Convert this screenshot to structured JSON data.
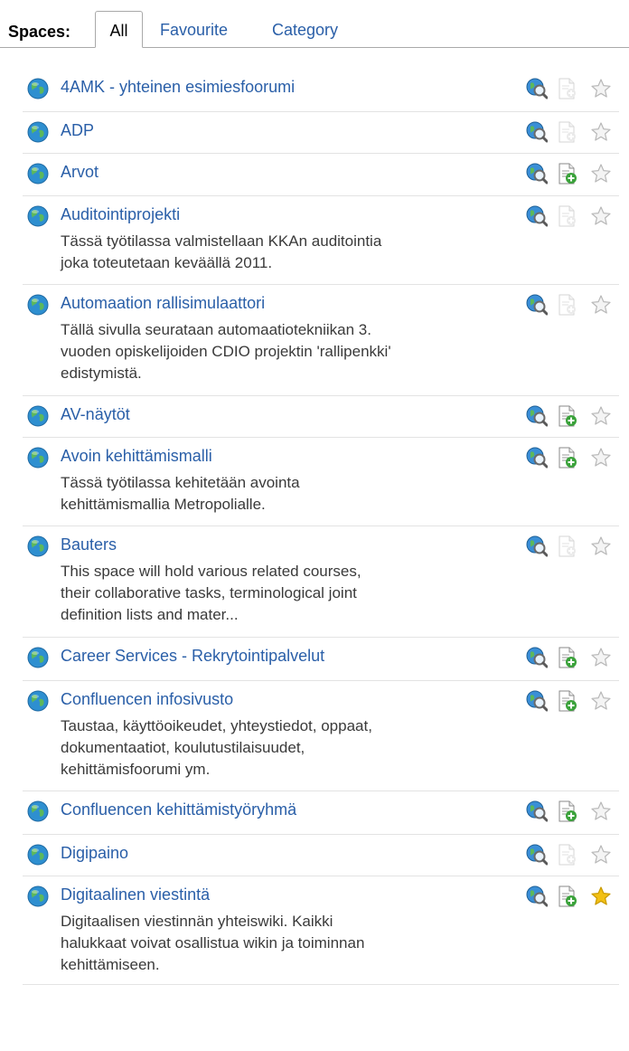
{
  "tabs": {
    "label": "Spaces:",
    "all": "All",
    "favourite": "Favourite",
    "category": "Category"
  },
  "colors": {
    "link": "#2a5fa8",
    "globe": "#2e8fd0",
    "add_enabled": "#3aa23a",
    "star_active": "#f2c014"
  },
  "spaces": [
    {
      "name": "4AMK - yhteinen esimiesfoorumi",
      "description": "",
      "add_page_enabled": false,
      "favourite": false
    },
    {
      "name": "ADP",
      "description": "",
      "add_page_enabled": false,
      "favourite": false
    },
    {
      "name": "Arvot",
      "description": "",
      "add_page_enabled": true,
      "favourite": false
    },
    {
      "name": "Auditointiprojekti",
      "description_lines": [
        "Tässä työtilassa valmistellaan KKAn auditointia",
        "joka toteutetaan keväällä 2011."
      ],
      "add_page_enabled": false,
      "favourite": false
    },
    {
      "name": "Automaation rallisimulaattori",
      "description_lines": [
        "Tällä sivulla seurataan automaatiotekniikan 3.",
        "vuoden opiskelijoiden CDIO projektin 'rallipenkki'",
        "edistymistä."
      ],
      "add_page_enabled": false,
      "favourite": false
    },
    {
      "name": "AV-näytöt",
      "description": "",
      "add_page_enabled": true,
      "favourite": false
    },
    {
      "name": "Avoin kehittämismalli",
      "description_lines": [
        "Tässä työtilassa kehitetään avointa",
        "kehittämismallia Metropolialle."
      ],
      "add_page_enabled": true,
      "favourite": false
    },
    {
      "name": "Bauters",
      "description_lines": [
        "This space will hold various related courses,",
        "their collaborative tasks, terminological joint",
        "definition lists and mater..."
      ],
      "add_page_enabled": false,
      "favourite": false
    },
    {
      "name": "Career Services - Rekrytointipalvelut",
      "description": "",
      "add_page_enabled": true,
      "favourite": false
    },
    {
      "name": "Confluencen infosivusto",
      "description_lines": [
        "Taustaa, käyttöoikeudet, yhteystiedot, oppaat,",
        "dokumentaatiot, koulutustilaisuudet,",
        "kehittämisfoorumi ym."
      ],
      "add_page_enabled": true,
      "favourite": false
    },
    {
      "name": "Confluencen kehittämistyöryhmä",
      "description": "",
      "add_page_enabled": true,
      "favourite": false
    },
    {
      "name": "Digipaino",
      "description": "",
      "add_page_enabled": false,
      "favourite": false
    },
    {
      "name": "Digitaalinen viestintä",
      "description_lines": [
        "Digitaalisen viestinnän yhteiswiki. Kaikki",
        "halukkaat voivat osallistua wikin ja toiminnan",
        "kehittämiseen."
      ],
      "add_page_enabled": true,
      "favourite": true
    }
  ]
}
